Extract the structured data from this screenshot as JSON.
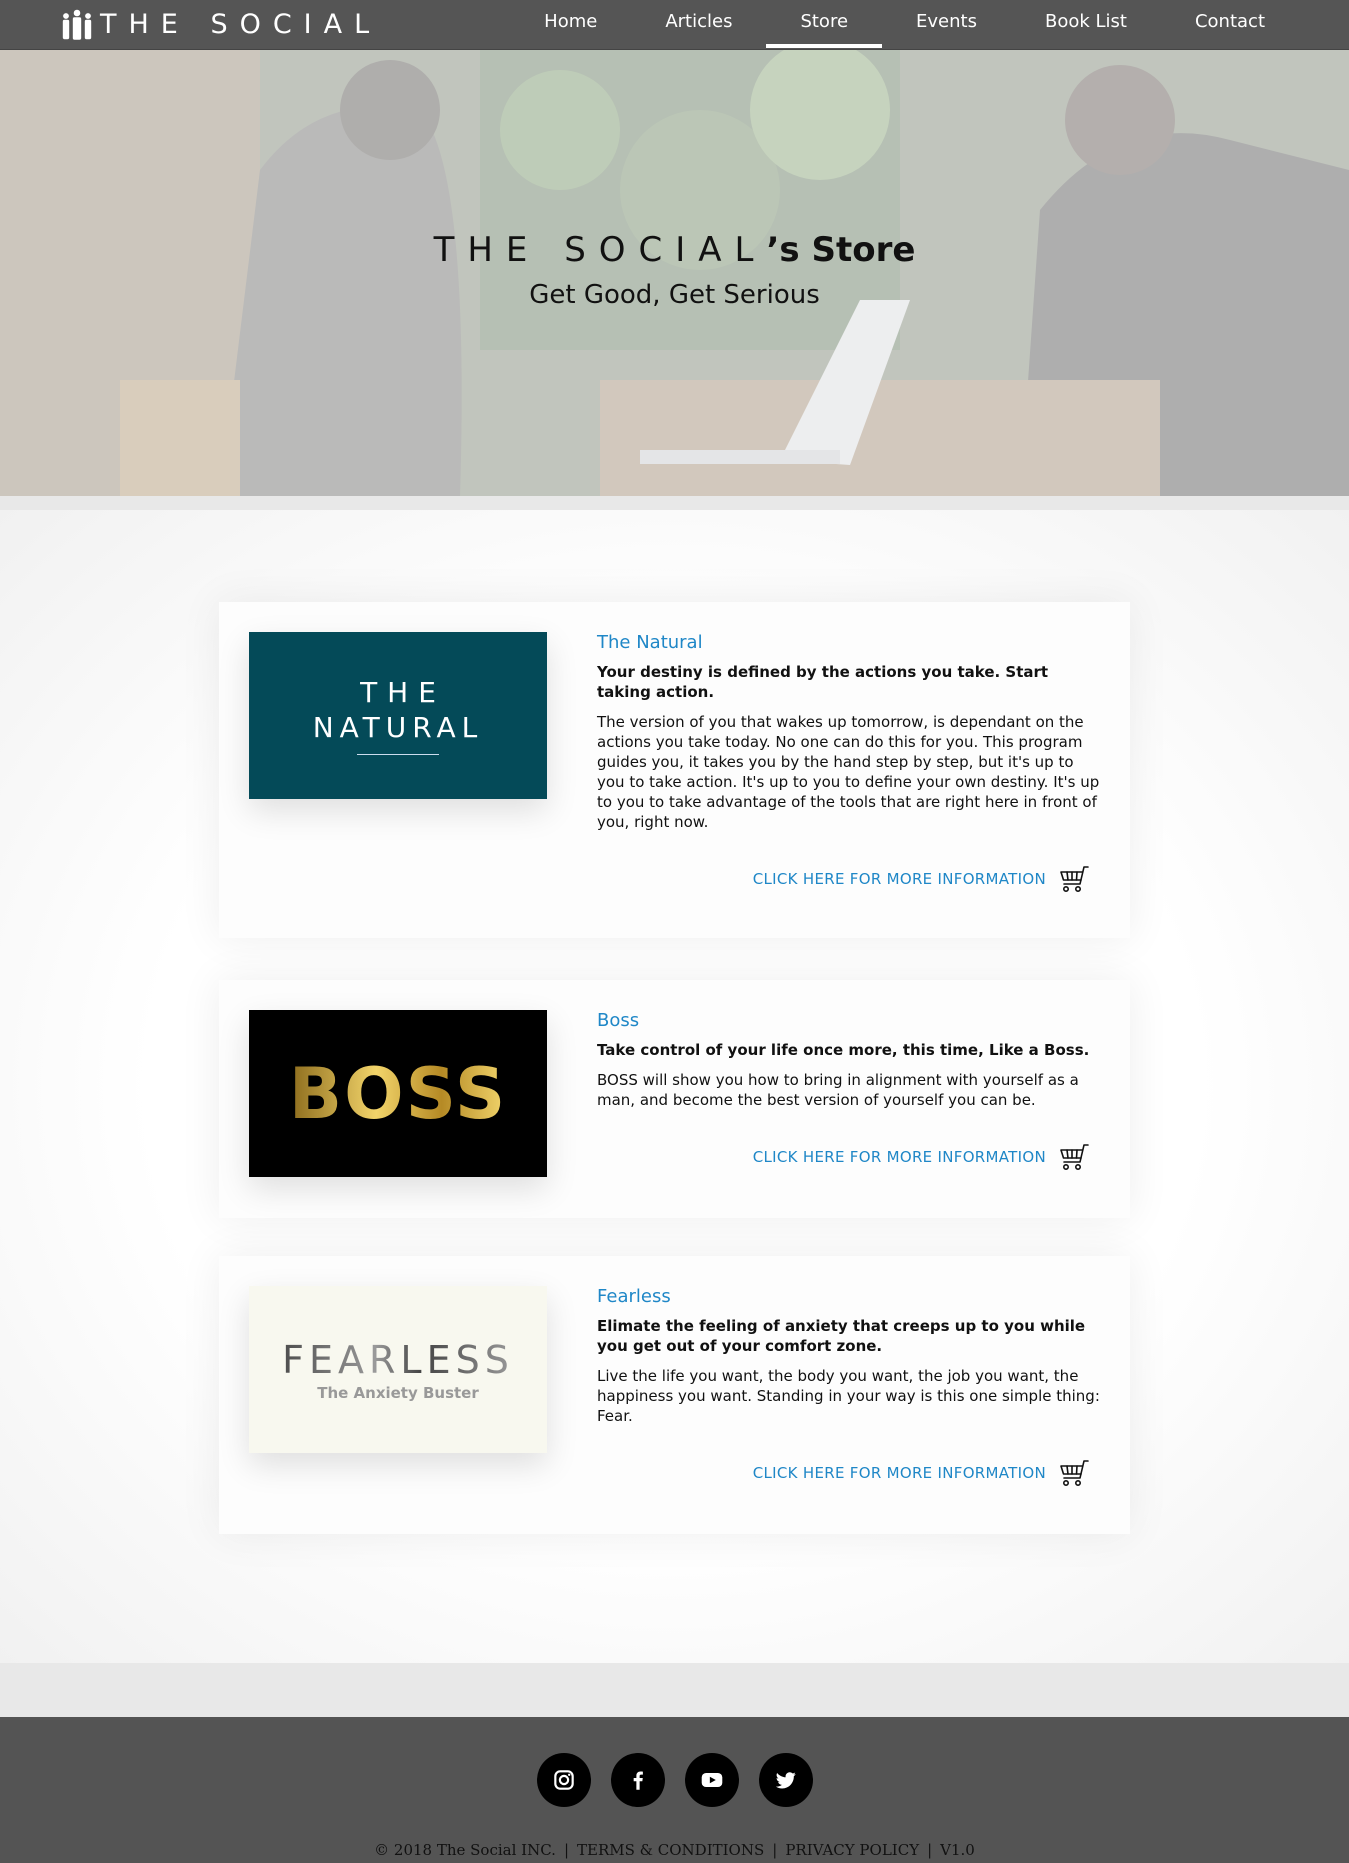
{
  "nav": {
    "brand": "THE SOCIAL",
    "items": [
      {
        "label": "Home",
        "active": false
      },
      {
        "label": "Articles",
        "active": false
      },
      {
        "label": "Store",
        "active": true
      },
      {
        "label": "Events",
        "active": false
      },
      {
        "label": "Book List",
        "active": false
      },
      {
        "label": "Contact",
        "active": false
      }
    ]
  },
  "hero": {
    "title_brand": "THE SOCIAL",
    "title_suffix": "’s Store",
    "subtitle": "Get Good, Get Serious"
  },
  "products": [
    {
      "image_line1": "THE",
      "image_line2": "NATURAL",
      "title": "The Natural",
      "tagline": "Your destiny is defined by the actions you take. Start taking action.",
      "description": "The version of you that wakes up tomorrow, is dependant on the actions you take today. No one can do this for you. This program guides you, it takes you by the hand step by step, but it's up to you to take action. It's up to you to define your own destiny. It's up to you to take advantage of the tools that are right here in front of you, right now.",
      "link_label": "CLICK HERE FOR MORE INFORMATION"
    },
    {
      "image_text": "BOSS",
      "title": "Boss",
      "tagline": "Take control of your life once more, this time, Like a Boss.",
      "description": "BOSS will show you how to bring in alignment with yourself as a man, and become the best version of yourself you can be.",
      "link_label": "CLICK HERE FOR MORE INFORMATION"
    },
    {
      "image_text": "FEARLESS",
      "image_sub": "The Anxiety Buster",
      "title": "Fearless",
      "tagline": "Elimate the feeling of anxiety that creeps up to you while you get out of your comfort zone.",
      "description": "Live the life you want, the body you want, the job you want, the happiness you want. Standing in your way is this one simple thing: Fear.",
      "link_label": "CLICK HERE FOR MORE INFORMATION"
    }
  ],
  "footer": {
    "socials": [
      "instagram-icon",
      "facebook-icon",
      "youtube-icon",
      "twitter-icon"
    ],
    "copyright": "© 2018 The Social INC.",
    "terms": "TERMS & CONDITIONS",
    "privacy": "PRIVACY POLICY",
    "version": "V1.0"
  },
  "colors": {
    "nav_bg": "#555555",
    "accent": "#1f87c7",
    "natural_bg": "#044a58",
    "footer_bg": "#545454"
  }
}
